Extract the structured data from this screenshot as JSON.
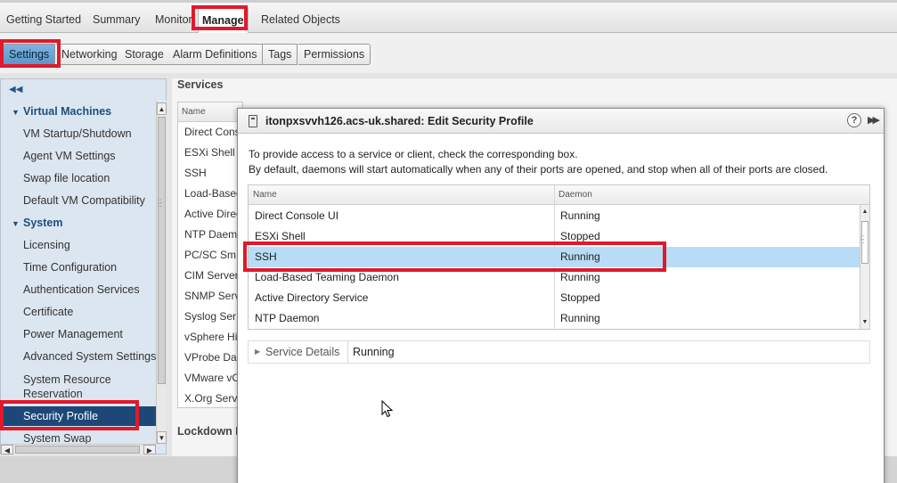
{
  "top_tabs": {
    "getting_started": "Getting Started",
    "summary": "Summary",
    "monitor": "Monitor",
    "manage": "Manage",
    "related_objects": "Related Objects"
  },
  "sub_tabs": {
    "settings": "Settings",
    "networking": "Networking",
    "storage": "Storage",
    "alarm_definitions": "Alarm Definitions",
    "tags": "Tags",
    "permissions": "Permissions"
  },
  "left_nav": {
    "virtual_machines": "Virtual Machines",
    "vm_items": [
      "VM Startup/Shutdown",
      "Agent VM Settings",
      "Swap file location",
      "Default VM Compatibility"
    ],
    "system": "System",
    "system_items": [
      "Licensing",
      "Time Configuration",
      "Authentication Services",
      "Certificate",
      "Power Management",
      "Advanced System Settings"
    ],
    "system_resource_reservation_1": "System Resource",
    "system_resource_reservation_2": "Reservation",
    "security_profile": "Security Profile",
    "system_swap": "System Swap"
  },
  "services_panel": {
    "title": "Services",
    "column_name": "Name",
    "rows": [
      "Direct Cons",
      "ESXi Shell",
      "SSH",
      "Load-Based",
      "Active Direc",
      "NTP Daem",
      "PC/SC Sm",
      "CIM Server",
      "SNMP Serv",
      "Syslog Ser",
      "vSphere Hi",
      "VProbe Da",
      "VMware vC",
      "X.Org Serv"
    ],
    "lockdown_label": "Lockdown M"
  },
  "modal": {
    "title": "itonpxsvvh126.acs-uk.shared: Edit Security Profile",
    "help_glyph": "?",
    "expand_glyph": "▶▶",
    "description_line1": "To provide access to a service or client, check the corresponding box.",
    "description_line2": "By default, daemons will start automatically when any of their ports are opened, and stop when all of their ports are closed.",
    "columns": {
      "name": "Name",
      "daemon": "Daemon"
    },
    "rows": [
      {
        "name": "Direct Console UI",
        "daemon": "Running"
      },
      {
        "name": "ESXi Shell",
        "daemon": "Stopped"
      },
      {
        "name": "SSH",
        "daemon": "Running"
      },
      {
        "name": "Load-Based Teaming Daemon",
        "daemon": "Running"
      },
      {
        "name": "Active Directory Service",
        "daemon": "Stopped"
      },
      {
        "name": "NTP Daemon",
        "daemon": "Running"
      }
    ],
    "selected_row": "SSH",
    "details": {
      "label": "Service Details",
      "value": "Running"
    }
  },
  "colors": {
    "highlight": "#e0192b",
    "selection": "#b8dcf5",
    "nav_selected": "#1d4777",
    "active_subtab": "#5a97cd"
  },
  "icons": {
    "collapse_nav": "double-chevron-left-icon",
    "group_caret": "triangle-down-icon",
    "host": "host-icon",
    "help": "help-icon",
    "expand": "double-chevron-right-icon",
    "details_caret": "triangle-right-icon",
    "cursor": "mouse-pointer-icon"
  }
}
